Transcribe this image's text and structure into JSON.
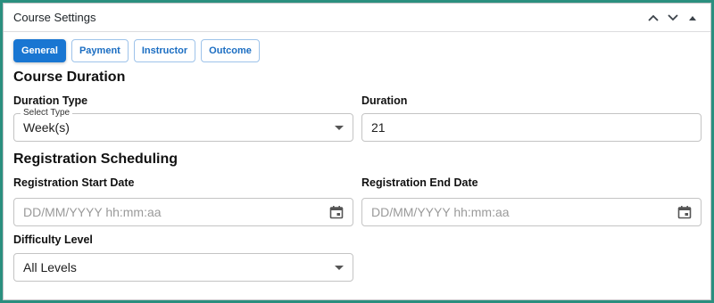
{
  "panel": {
    "title": "Course Settings",
    "controls": [
      "move-up",
      "move-down",
      "collapse"
    ]
  },
  "tabs": [
    {
      "label": "General",
      "active": true
    },
    {
      "label": "Payment",
      "active": false
    },
    {
      "label": "Instructor",
      "active": false
    },
    {
      "label": "Outcome",
      "active": false
    }
  ],
  "course_duration": {
    "heading": "Course Duration",
    "duration_type": {
      "label": "Duration Type",
      "floating_label": "Select Type",
      "value": "Week(s)"
    },
    "duration": {
      "label": "Duration",
      "value": "21"
    }
  },
  "registration": {
    "heading": "Registration Scheduling",
    "start_date": {
      "label": "Registration Start Date",
      "placeholder": "DD/MM/YYYY hh:mm:aa"
    },
    "end_date": {
      "label": "Registration End Date",
      "placeholder": "DD/MM/YYYY hh:mm:aa"
    }
  },
  "difficulty": {
    "label": "Difficulty Level",
    "value": "All Levels"
  },
  "colors": {
    "frame": "#2a8f7f",
    "accent": "#1976d2",
    "tab_text": "#1a6dc2"
  },
  "icons": {
    "move_up": "chevron-up-icon",
    "move_down": "chevron-down-icon",
    "collapse": "triangle-up-icon",
    "date_picker": "calendar-icon",
    "select": "caret-down-icon"
  }
}
